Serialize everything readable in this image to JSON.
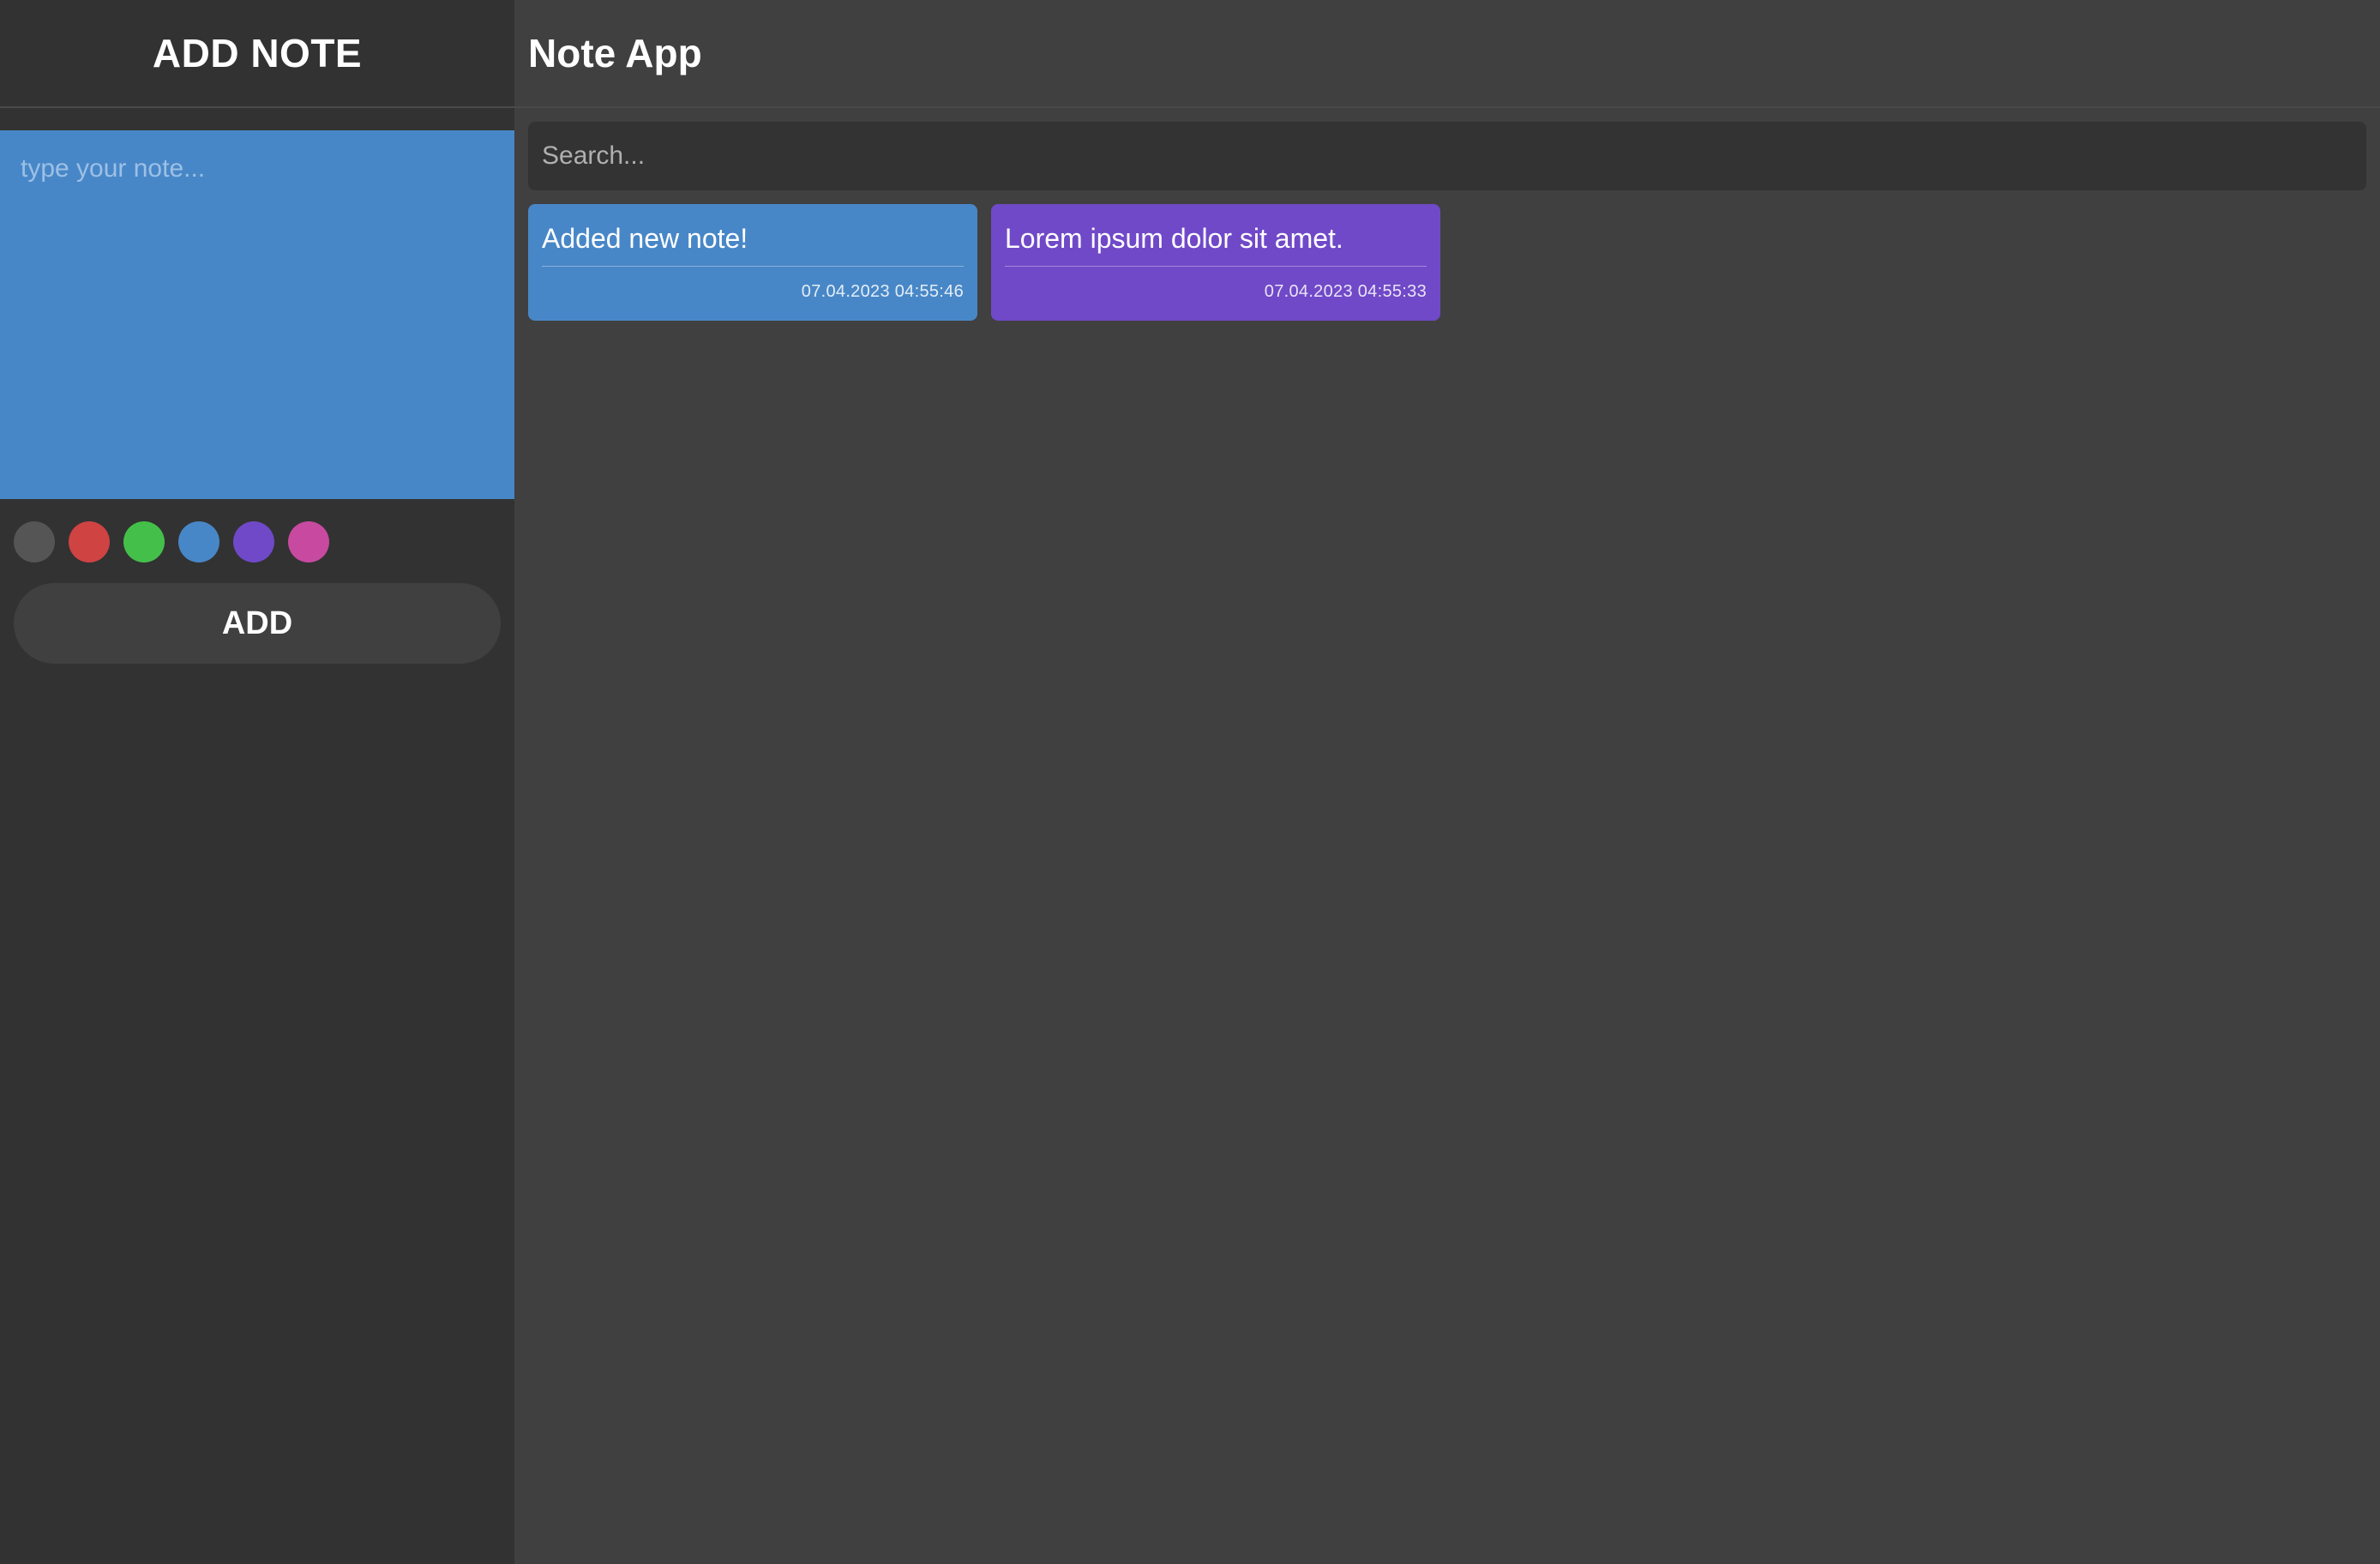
{
  "sidebar": {
    "title": "ADD NOTE",
    "textarea_placeholder": "type your note...",
    "textarea_color": "#4887c7",
    "colors": [
      {
        "name": "gray",
        "hex": "#555555"
      },
      {
        "name": "red",
        "hex": "#d04343"
      },
      {
        "name": "green",
        "hex": "#44c04a"
      },
      {
        "name": "blue",
        "hex": "#4887c7"
      },
      {
        "name": "purple",
        "hex": "#7049c8"
      },
      {
        "name": "pink",
        "hex": "#c84aa0"
      }
    ],
    "add_label": "ADD"
  },
  "main": {
    "title": "Note App",
    "search_placeholder": "Search...",
    "notes": [
      {
        "text": "Added new note!",
        "date": "07.04.2023 04:55:46",
        "color": "#4887c7"
      },
      {
        "text": "Lorem ipsum dolor sit amet.",
        "date": "07.04.2023 04:55:33",
        "color": "#7049c8"
      }
    ]
  }
}
